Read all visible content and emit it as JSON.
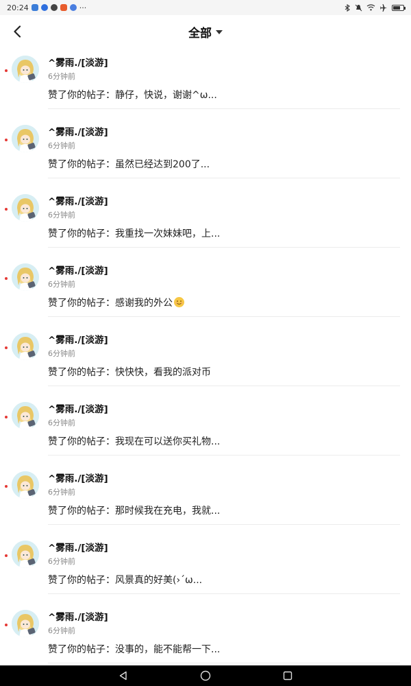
{
  "status_bar": {
    "time": "20:24",
    "more": "···"
  },
  "header": {
    "title": "全部"
  },
  "notifications": [
    {
      "user": "^雾雨./[淡游]",
      "time": "6分钟前",
      "text": "赞了你的帖子：静仔，快说，谢谢^ω..."
    },
    {
      "user": "^雾雨./[淡游]",
      "time": "6分钟前",
      "text": "赞了你的帖子：虽然已经达到200了..."
    },
    {
      "user": "^雾雨./[淡游]",
      "time": "6分钟前",
      "text": "赞了你的帖子：我重找一次妹妹吧，上..."
    },
    {
      "user": "^雾雨./[淡游]",
      "time": "6分钟前",
      "text": "赞了你的帖子：感谢我的外公",
      "emoji": "smile-emoji"
    },
    {
      "user": "^雾雨./[淡游]",
      "time": "6分钟前",
      "text": "赞了你的帖子：快快快，看我的派对币"
    },
    {
      "user": "^雾雨./[淡游]",
      "time": "6分钟前",
      "text": "赞了你的帖子：我现在可以送你买礼物..."
    },
    {
      "user": "^雾雨./[淡游]",
      "time": "6分钟前",
      "text": "赞了你的帖子：那时候我在充电，我就..."
    },
    {
      "user": "^雾雨./[淡游]",
      "time": "6分钟前",
      "text": "赞了你的帖子：风景真的好美(›´ω..."
    },
    {
      "user": "^雾雨./[淡游]",
      "time": "6分钟前",
      "text": "赞了你的帖子：没事的，能不能帮一下..."
    }
  ],
  "colors": {
    "unread_dot": "#e53935",
    "divider": "#ececec"
  }
}
